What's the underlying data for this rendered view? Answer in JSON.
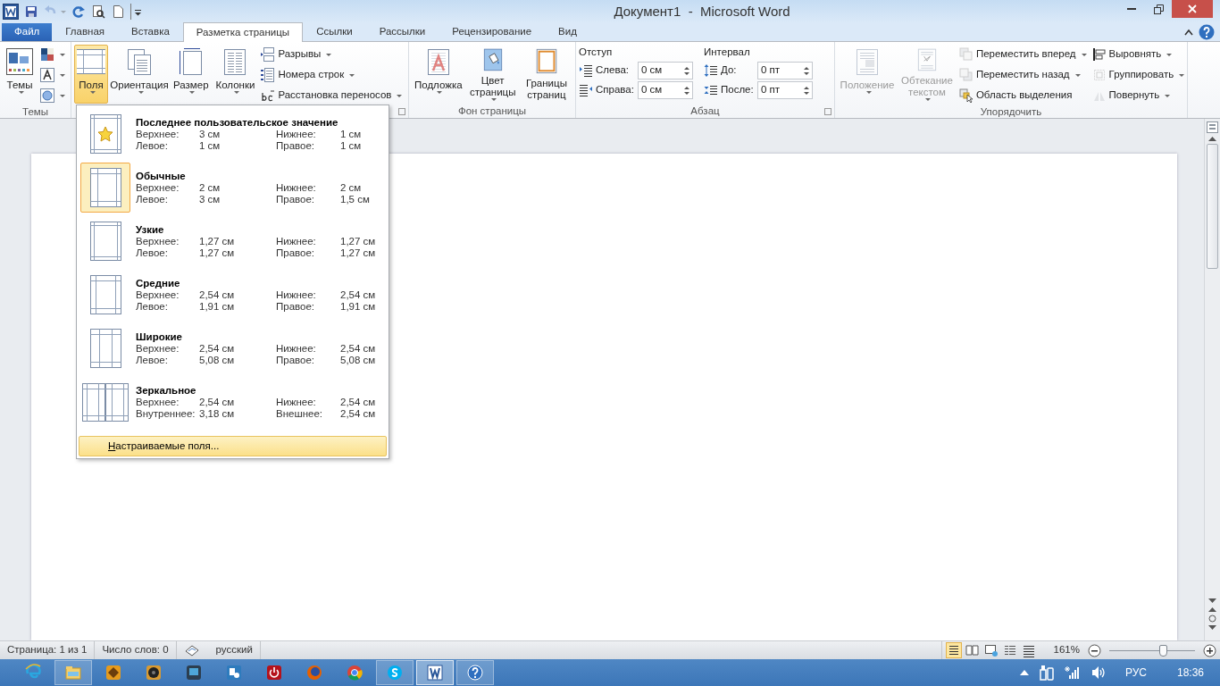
{
  "window": {
    "title": "Документ1  -  Microsoft Word"
  },
  "quick_access": [
    {
      "kind": "save",
      "disabled": false
    },
    {
      "kind": "undo",
      "disabled": true
    },
    {
      "kind": "redo",
      "disabled": false
    },
    {
      "kind": "preview",
      "disabled": false
    },
    {
      "kind": "new",
      "disabled": false
    }
  ],
  "tabs": [
    {
      "label": "Файл",
      "kind": "file",
      "selected": false
    },
    {
      "label": "Главная",
      "kind": "tab",
      "selected": false
    },
    {
      "label": "Вставка",
      "kind": "tab",
      "selected": false
    },
    {
      "label": "Разметка страницы",
      "kind": "tab",
      "selected": true
    },
    {
      "label": "Ссылки",
      "kind": "tab",
      "selected": false
    },
    {
      "label": "Рассылки",
      "kind": "tab",
      "selected": false
    },
    {
      "label": "Рецензирование",
      "kind": "tab",
      "selected": false
    },
    {
      "label": "Вид",
      "kind": "tab",
      "selected": false
    }
  ],
  "ribbon": {
    "groups": [
      {
        "label": "Темы",
        "columns": [
          [
            {
              "kind": "large",
              "label": "Темы",
              "dropdown": true,
              "disabled": false,
              "pressed": false
            }
          ],
          [
            {
              "kind": "icon",
              "dropdown": true
            },
            {
              "kind": "icon",
              "dropdown": true
            },
            {
              "kind": "icon",
              "dropdown": true
            }
          ]
        ]
      },
      {
        "launcher": true,
        "columns": [
          [
            {
              "kind": "large",
              "label": "Поля",
              "dropdown": true,
              "disabled": false,
              "pressed": true
            }
          ],
          [
            {
              "kind": "large",
              "label": "Ориентация",
              "dropdown": true,
              "disabled": false,
              "pressed": false
            }
          ],
          [
            {
              "kind": "large",
              "label": "Размер",
              "dropdown": true,
              "disabled": false,
              "pressed": false
            }
          ],
          [
            {
              "kind": "large",
              "label": "Колонки",
              "dropdown": true,
              "disabled": false,
              "pressed": false
            }
          ],
          [
            {
              "kind": "small",
              "label": "Разрывы",
              "dropdown": true,
              "disabled": false
            },
            {
              "kind": "small",
              "label": "Номера строк",
              "dropdown": true,
              "disabled": false
            },
            {
              "kind": "small",
              "label": "Расстановка переносов",
              "dropdown": true,
              "disabled": false
            }
          ]
        ]
      },
      {
        "label": "Фон страницы",
        "columns": [
          [
            {
              "kind": "large",
              "label": "Подложка",
              "dropdown": true,
              "disabled": false,
              "pressed": false
            }
          ],
          [
            {
              "kind": "large",
              "label": "Цвет страницы",
              "dropdown": true,
              "disabled": false,
              "pressed": false
            }
          ],
          [
            {
              "kind": "large",
              "label": "Границы страниц",
              "dropdown": false,
              "disabled": false,
              "pressed": false
            }
          ]
        ]
      },
      {
        "label": "Абзац",
        "launcher": true,
        "columns": [
          [
            {
              "kind": "heading",
              "label": "Отступ"
            },
            {
              "kind": "spin",
              "label": "Слева:",
              "value": "0 см"
            },
            {
              "kind": "spin",
              "label": "Справа:",
              "value": "0 см"
            }
          ],
          [
            {
              "kind": "heading",
              "label": "Интервал"
            },
            {
              "kind": "spin",
              "label": "До:",
              "value": "0 пт"
            },
            {
              "kind": "spin",
              "label": "После:",
              "value": "0 пт"
            }
          ]
        ]
      },
      {
        "label": "Упорядочить",
        "columns": [
          [
            {
              "kind": "large",
              "label": "Положение",
              "dropdown": true,
              "disabled": true,
              "pressed": false
            }
          ],
          [
            {
              "kind": "large",
              "label": "Обтекание текстом",
              "dropdown": true,
              "disabled": true,
              "pressed": false
            }
          ],
          [
            {
              "kind": "small",
              "label": "Переместить вперед",
              "dropdown": true,
              "disabled": true
            },
            {
              "kind": "small",
              "label": "Переместить назад",
              "dropdown": true,
              "disabled": true
            },
            {
              "kind": "small",
              "label": "Область выделения",
              "dropdown": false,
              "disabled": false
            }
          ],
          [
            {
              "kind": "small",
              "label": "Выровнять",
              "dropdown": true,
              "disabled": false
            },
            {
              "kind": "small",
              "label": "Группировать",
              "dropdown": true,
              "disabled": true
            },
            {
              "kind": "small",
              "label": "Повернуть",
              "dropdown": true,
              "disabled": true
            }
          ]
        ]
      }
    ]
  },
  "margins_menu": {
    "items": [
      {
        "kind": "custom",
        "name": "Последнее пользовательское значение",
        "selected": false,
        "rows": [
          [
            "Верхнее:",
            "3 см",
            "Нижнее:",
            "1 см"
          ],
          [
            "Левое:",
            "1 см",
            "Правое:",
            "1 см"
          ]
        ]
      },
      {
        "kind": "normal",
        "name": "Обычные",
        "selected": true,
        "rows": [
          [
            "Верхнее:",
            "2 см",
            "Нижнее:",
            "2 см"
          ],
          [
            "Левое:",
            "3 см",
            "Правое:",
            "1,5 см"
          ]
        ]
      },
      {
        "kind": "narrow",
        "name": "Узкие",
        "selected": false,
        "rows": [
          [
            "Верхнее:",
            "1,27 см",
            "Нижнее:",
            "1,27 см"
          ],
          [
            "Левое:",
            "1,27 см",
            "Правое:",
            "1,27 см"
          ]
        ]
      },
      {
        "kind": "moderate",
        "name": "Средние",
        "selected": false,
        "rows": [
          [
            "Верхнее:",
            "2,54 см",
            "Нижнее:",
            "2,54 см"
          ],
          [
            "Левое:",
            "1,91 см",
            "Правое:",
            "1,91 см"
          ]
        ]
      },
      {
        "kind": "wide",
        "name": "Широкие",
        "selected": false,
        "rows": [
          [
            "Верхнее:",
            "2,54 см",
            "Нижнее:",
            "2,54 см"
          ],
          [
            "Левое:",
            "5,08 см",
            "Правое:",
            "5,08 см"
          ]
        ]
      },
      {
        "kind": "mirrored",
        "name": "Зеркальное",
        "selected": false,
        "rows": [
          [
            "Верхнее:",
            "2,54 см",
            "Нижнее:",
            "2,54 см"
          ],
          [
            "Внутреннее:",
            "3,18 см",
            "Внешнее:",
            "2,54 см"
          ]
        ]
      }
    ],
    "footer": {
      "label": "Настраиваемые поля...",
      "highlighted": true
    }
  },
  "status_bar": {
    "page": "Страница: 1 из 1",
    "words": "Число слов: 0",
    "language": "русский",
    "views": [
      {
        "kind": "print",
        "selected": true
      },
      {
        "kind": "reading",
        "selected": false
      },
      {
        "kind": "web",
        "selected": false
      },
      {
        "kind": "outline",
        "selected": false
      },
      {
        "kind": "draft",
        "selected": false
      }
    ],
    "zoom": {
      "reading": "161%",
      "level": 0.62
    }
  },
  "taskbar": {
    "apps": [
      {
        "kind": "ie",
        "open": false,
        "active": false
      },
      {
        "kind": "explorer",
        "open": true,
        "active": false
      },
      {
        "kind": "app_grid",
        "open": false,
        "active": false
      },
      {
        "kind": "speaker",
        "open": false,
        "active": false
      },
      {
        "kind": "monitor",
        "open": false,
        "active": false
      },
      {
        "kind": "settings",
        "open": false,
        "active": false
      },
      {
        "kind": "power",
        "open": false,
        "active": false
      },
      {
        "kind": "firefox",
        "open": false,
        "active": false
      },
      {
        "kind": "chrome",
        "open": false,
        "active": false
      },
      {
        "kind": "skype",
        "open": true,
        "active": false
      },
      {
        "kind": "word",
        "open": true,
        "active": true
      },
      {
        "kind": "help",
        "open": true,
        "active": false
      }
    ],
    "tray": {
      "language": "РУС",
      "time": "18:36"
    }
  }
}
